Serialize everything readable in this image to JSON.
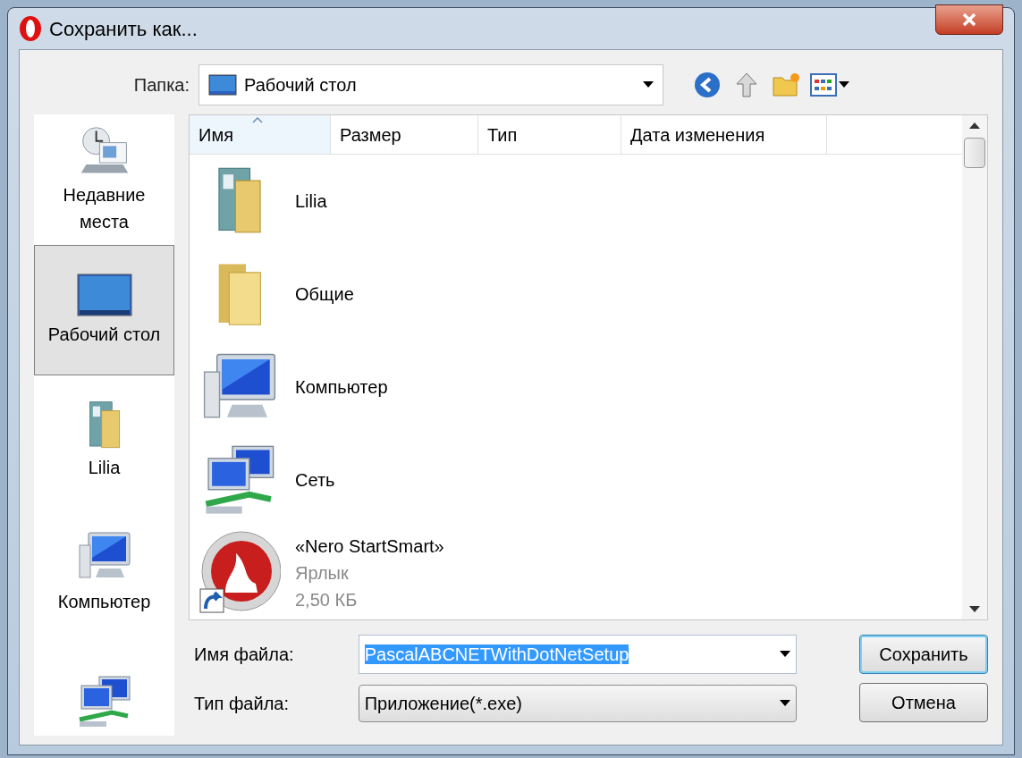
{
  "window": {
    "title": "Сохранить как..."
  },
  "folder": {
    "label": "Папка:",
    "value": "Рабочий стол"
  },
  "places": [
    {
      "kind": "recent",
      "label": "Недавние места",
      "selected": false
    },
    {
      "kind": "desktop",
      "label": "Рабочий стол",
      "selected": true
    },
    {
      "kind": "user",
      "label": "Lilia",
      "selected": false
    },
    {
      "kind": "computer",
      "label": "Компьютер",
      "selected": false
    },
    {
      "kind": "network",
      "selected": false
    }
  ],
  "columns": [
    {
      "label": "Имя",
      "sorted": true
    },
    {
      "label": "Размер",
      "sorted": false
    },
    {
      "label": "Тип",
      "sorted": false
    },
    {
      "label": "Дата изменения",
      "sorted": false
    }
  ],
  "files": [
    {
      "kind": "user",
      "name": "Lilia"
    },
    {
      "kind": "folder",
      "name": "Общие"
    },
    {
      "kind": "computer",
      "name": "Компьютер"
    },
    {
      "kind": "network",
      "name": "Сеть"
    },
    {
      "kind": "shortcut",
      "name": "«Nero StartSmart»",
      "details": [
        "Ярлык",
        "2,50 КБ"
      ]
    }
  ],
  "filename": {
    "label": "Имя файла:",
    "value": "PascalABCNETWithDotNetSetup",
    "text_selected": true
  },
  "filetype": {
    "label": "Тип файла:",
    "value": "Приложение(*.exe)"
  },
  "buttons": [
    {
      "label": "Сохранить",
      "default": true
    },
    {
      "label": "Отмена",
      "default": false
    }
  ]
}
